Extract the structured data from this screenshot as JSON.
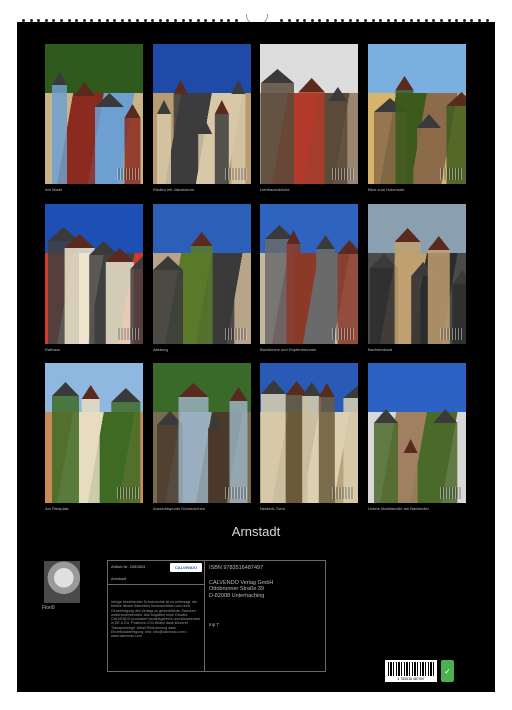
{
  "calendar": {
    "title": "Arnstadt",
    "photos": [
      {
        "caption": "Am Markt",
        "scene": "town-square",
        "colors": [
          "#2f5a1e",
          "#c9b48a",
          "#8b2a1e",
          "#6da0d0"
        ]
      },
      {
        "caption": "Riedtor mit Jakobsturm",
        "scene": "tower-gate",
        "colors": [
          "#1f4aa8",
          "#b89b70",
          "#3c3c3c",
          "#d8c8a8"
        ]
      },
      {
        "caption": "Liebfrauenkirche",
        "scene": "church",
        "colors": [
          "#dcdcdc",
          "#9a8670",
          "#b33b2c",
          "#5a4a3a"
        ]
      },
      {
        "caption": "Blick zum Holzmarkt",
        "scene": "market-view",
        "colors": [
          "#7ab0e0",
          "#d6b56a",
          "#3d5a1c",
          "#8b6b4a"
        ]
      },
      {
        "caption": "Rathaus",
        "scene": "town-hall",
        "colors": [
          "#1e4fb5",
          "#d2392a",
          "#efe4cc",
          "#404040"
        ]
      },
      {
        "caption": "Alteburg",
        "scene": "stone-tower",
        "colors": [
          "#2b5fb8",
          "#b8a488",
          "#5a7a2a",
          "#3a3a3a"
        ]
      },
      {
        "caption": "Bachkirche und Hopfenbrunnen",
        "scene": "fountain",
        "colors": [
          "#2f63c0",
          "#c3b8a0",
          "#8b3a2a",
          "#6a6a6a"
        ]
      },
      {
        "caption": "Bachdenkmal",
        "scene": "statue",
        "colors": [
          "#8aa0b0",
          "#4a4a4a",
          "#c0a070",
          "#2c2c2c"
        ]
      },
      {
        "caption": "Am Riedplatz",
        "scene": "half-timbered-house",
        "colors": [
          "#8fb8e0",
          "#c98a5a",
          "#e6dcc0",
          "#3e6a24"
        ]
      },
      {
        "caption": "Aussichtspunkt Schneckchen",
        "scene": "stone-steps",
        "colors": [
          "#3a6a2a",
          "#7a6a50",
          "#9ab0c0",
          "#4a3a2a"
        ]
      },
      {
        "caption": "Neideck-Turm",
        "scene": "round-tower",
        "colors": [
          "#2a5ab8",
          "#b8a47a",
          "#6a5a3a",
          "#dcd0b0"
        ]
      },
      {
        "caption": "Untere Marktstraße am Bachkeller",
        "scene": "sculpture",
        "colors": [
          "#2c62c4",
          "#d8d8d8",
          "#a08060",
          "#4a6a2a"
        ]
      }
    ]
  },
  "footer": {
    "author_name": "Flori0",
    "article_no": "Artikel-Nr. 2083804",
    "logo_text": "CALVENDO",
    "place": "Arnstadt",
    "legal_text": "Infolge bestehender Schutzrechte ist es untersagt, die Motive dieses Kalenders herauszulösen und ohne Genehmigung des Verlags zu gewerblichen Zwecken weiterzuverwenden. Alle Angaben ohne Gewähr. CALVENDO produziert bedarfsgerecht und klimaneutral in DE & EU. Positives CO2-Bilanz dank kürzerer Transportwege. Abfall-Reduzierung dank Einzelstückfertigung. Info: info@calvendo.com • www.calvendo.com",
    "isbn": "ISBN 9783516487497",
    "publisher_lines": [
      "CALVENDO Verlag GmbH",
      "Ottobrunner Straße 39",
      "D-82008 Unterhaching"
    ],
    "edition": "Inp T.",
    "barcode_number": "4 783516 487497"
  }
}
